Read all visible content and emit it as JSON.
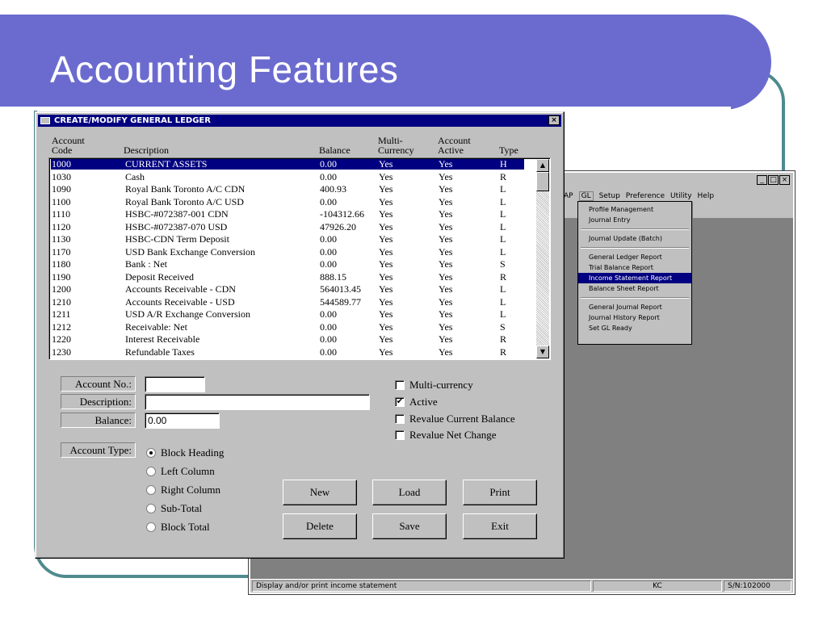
{
  "slide": {
    "title": "Accounting Features"
  },
  "app_window": {
    "controls": [
      "_",
      "□",
      "×"
    ],
    "menu": [
      {
        "label": "AP",
        "selected": false
      },
      {
        "label": "GL",
        "selected": true
      },
      {
        "label": "Setup",
        "selected": false
      },
      {
        "label": "Preference",
        "selected": false
      },
      {
        "label": "Utility",
        "selected": false
      },
      {
        "label": "Help",
        "selected": false
      }
    ],
    "gl_menu": {
      "groups": [
        [
          "Profile Management",
          "Journal Entry"
        ],
        [
          "Journal Update (Batch)"
        ],
        [
          "General Ledger Report",
          "Trial Balance Report",
          "Income Statement Report",
          "Balance Sheet Report"
        ],
        [
          "General Journal Report",
          "Journal History Report",
          "Set GL Ready"
        ]
      ],
      "selected": "Income Statement Report"
    },
    "status": {
      "message": "Display and/or print income statement",
      "user": "KC",
      "serial": "S/N:102000"
    }
  },
  "dialog": {
    "title": "CREATE/MODIFY GENERAL LEDGER",
    "close": "×",
    "headers": {
      "code_1": "Account",
      "code_2": "Code",
      "desc": "Description",
      "balance": "Balance",
      "multi_1": "Multi-",
      "multi_2": "Currency",
      "active_1": "Account",
      "active_2": "Active",
      "type": "Type"
    },
    "accounts": [
      {
        "code": "1000",
        "desc": "CURRENT ASSETS",
        "balance": "0.00",
        "multi": "Yes",
        "active": "Yes",
        "type": "H",
        "selected": true
      },
      {
        "code": "1030",
        "desc": "Cash",
        "balance": "0.00",
        "multi": "Yes",
        "active": "Yes",
        "type": "R"
      },
      {
        "code": "1090",
        "desc": "Royal Bank Toronto A/C CDN",
        "balance": "400.93",
        "multi": "Yes",
        "active": "Yes",
        "type": "L"
      },
      {
        "code": "1100",
        "desc": "Royal Bank Toronto A/C USD",
        "balance": "0.00",
        "multi": "Yes",
        "active": "Yes",
        "type": "L"
      },
      {
        "code": "1110",
        "desc": "HSBC-#072387-001 CDN",
        "balance": "-104312.66",
        "multi": "Yes",
        "active": "Yes",
        "type": "L"
      },
      {
        "code": "1120",
        "desc": "HSBC-#072387-070 USD",
        "balance": "47926.20",
        "multi": "Yes",
        "active": "Yes",
        "type": "L"
      },
      {
        "code": "1130",
        "desc": "HSBC-CDN Term Deposit",
        "balance": "0.00",
        "multi": "Yes",
        "active": "Yes",
        "type": "L"
      },
      {
        "code": "1170",
        "desc": "USD Bank Exchange Conversion",
        "balance": "0.00",
        "multi": "Yes",
        "active": "Yes",
        "type": "L"
      },
      {
        "code": "1180",
        "desc": "Bank : Net",
        "balance": "0.00",
        "multi": "Yes",
        "active": "Yes",
        "type": "S"
      },
      {
        "code": "1190",
        "desc": "Deposit Received",
        "balance": "888.15",
        "multi": "Yes",
        "active": "Yes",
        "type": "R"
      },
      {
        "code": "1200",
        "desc": "Accounts Receivable - CDN",
        "balance": "564013.45",
        "multi": "Yes",
        "active": "Yes",
        "type": "L"
      },
      {
        "code": "1210",
        "desc": "Accounts Receivable - USD",
        "balance": "544589.77",
        "multi": "Yes",
        "active": "Yes",
        "type": "L"
      },
      {
        "code": "1211",
        "desc": "USD A/R Exchange Conversion",
        "balance": "0.00",
        "multi": "Yes",
        "active": "Yes",
        "type": "L"
      },
      {
        "code": "1212",
        "desc": "Receivable: Net",
        "balance": "0.00",
        "multi": "Yes",
        "active": "Yes",
        "type": "S"
      },
      {
        "code": "1220",
        "desc": "Interest Receivable",
        "balance": "0.00",
        "multi": "Yes",
        "active": "Yes",
        "type": "R"
      },
      {
        "code": "1230",
        "desc": "Refundable Taxes",
        "balance": "0.00",
        "multi": "Yes",
        "active": "Yes",
        "type": "R"
      }
    ],
    "form": {
      "account_no_label": "Account No.:",
      "account_no_value": "",
      "description_label": "Description:",
      "description_value": "",
      "balance_label": "Balance:",
      "balance_value": "0.00",
      "account_type_label": "Account Type:"
    },
    "checkboxes": [
      {
        "label": "Multi-currency",
        "checked": false
      },
      {
        "label": "Active",
        "checked": true
      },
      {
        "label": "Revalue Current Balance",
        "checked": false
      },
      {
        "label": "Revalue Net Change",
        "checked": false
      }
    ],
    "account_types": [
      {
        "label": "Block Heading",
        "selected": true
      },
      {
        "label": "Left Column",
        "selected": false
      },
      {
        "label": "Right Column",
        "selected": false
      },
      {
        "label": "Sub-Total",
        "selected": false
      },
      {
        "label": "Block Total",
        "selected": false
      }
    ],
    "buttons": {
      "new": "New",
      "load": "Load",
      "print": "Print",
      "delete": "Delete",
      "save": "Save",
      "exit": "Exit"
    },
    "scroll": {
      "up": "▲",
      "down": "▼"
    }
  }
}
